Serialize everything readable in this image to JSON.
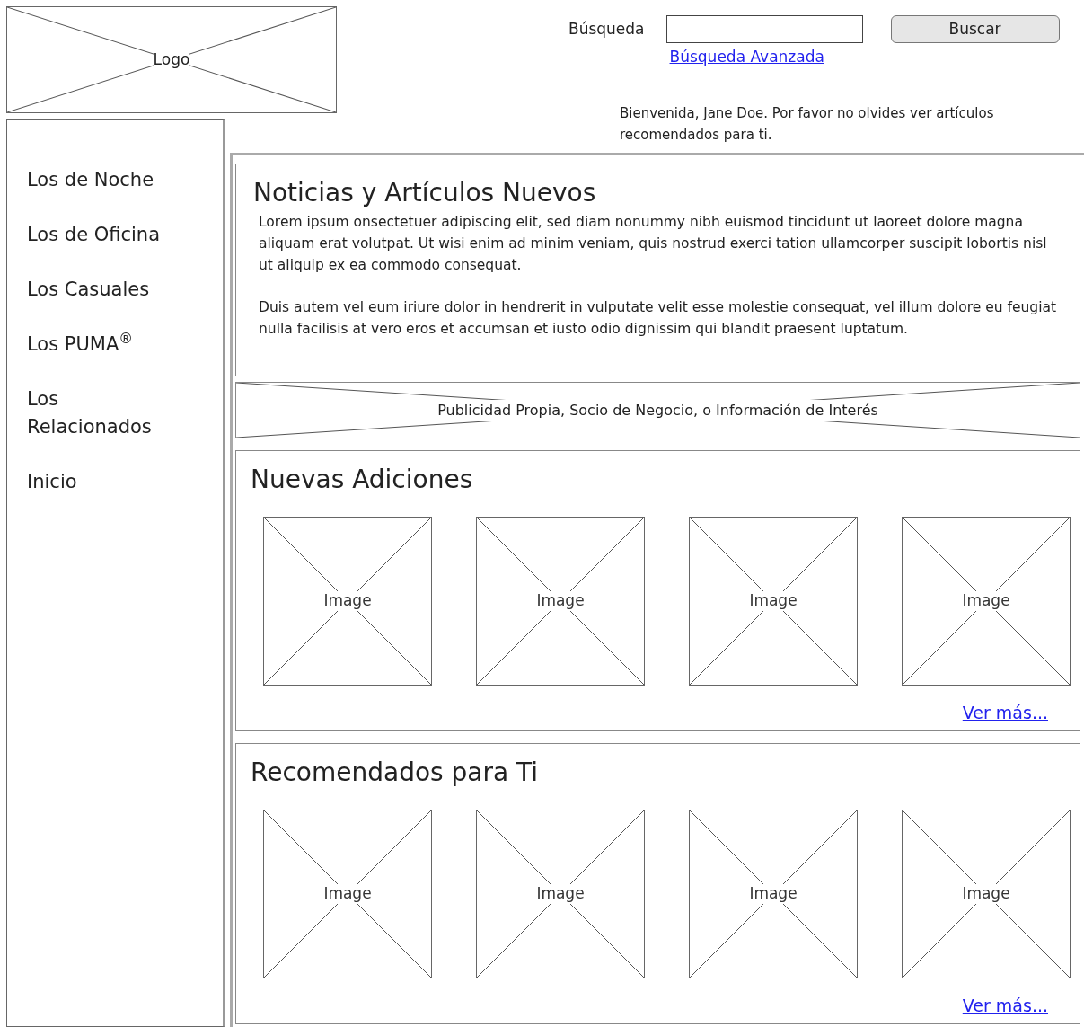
{
  "header": {
    "logo": "Logo",
    "search": {
      "label": "Búsqueda",
      "button": "Buscar",
      "advanced_link": "Búsqueda Avanzada"
    },
    "welcome": "Bienvenida, Jane Doe. Por favor no olvides ver artículos recomendados para ti."
  },
  "sidebar": {
    "items": [
      {
        "label": "Los de Noche"
      },
      {
        "label": "Los de Oficina"
      },
      {
        "label": "Los Casuales"
      },
      {
        "label": "Los PUMA$^{®}$"
      },
      {
        "label": "Los Relacionados"
      },
      {
        "label": "Inicio"
      }
    ]
  },
  "news": {
    "title": "Noticias y Artículos Nuevos",
    "paragraphs": [
      "Lorem ipsum onsectetuer adipiscing elit, sed diam nonummy nibh euismod tincidunt ut laoreet dolore magna aliquam erat volutpat. Ut wisi enim ad minim veniam, quis nostrud exerci tation ullamcorper suscipit lobortis nisl ut aliquip ex ea commodo consequat.",
      "Duis autem vel eum iriure dolor in hendrerit in vulputate velit esse molestie consequat, vel illum dolore eu feugiat nulla facilisis at vero eros et accumsan et iusto odio dignissim qui blandit praesent luptatum."
    ]
  },
  "ad_banner": "Publicidad Propia, Socio de Negocio, o Información de Interés",
  "sections": [
    {
      "title": "Nuevas Adiciones",
      "images": [
        "Image",
        "Image",
        "Image",
        "Image"
      ],
      "more_link": "Ver más..."
    },
    {
      "title": "Recomendados para Ti",
      "images": [
        "Image",
        "Image",
        "Image",
        "Image"
      ],
      "more_link": "Ver más..."
    }
  ]
}
